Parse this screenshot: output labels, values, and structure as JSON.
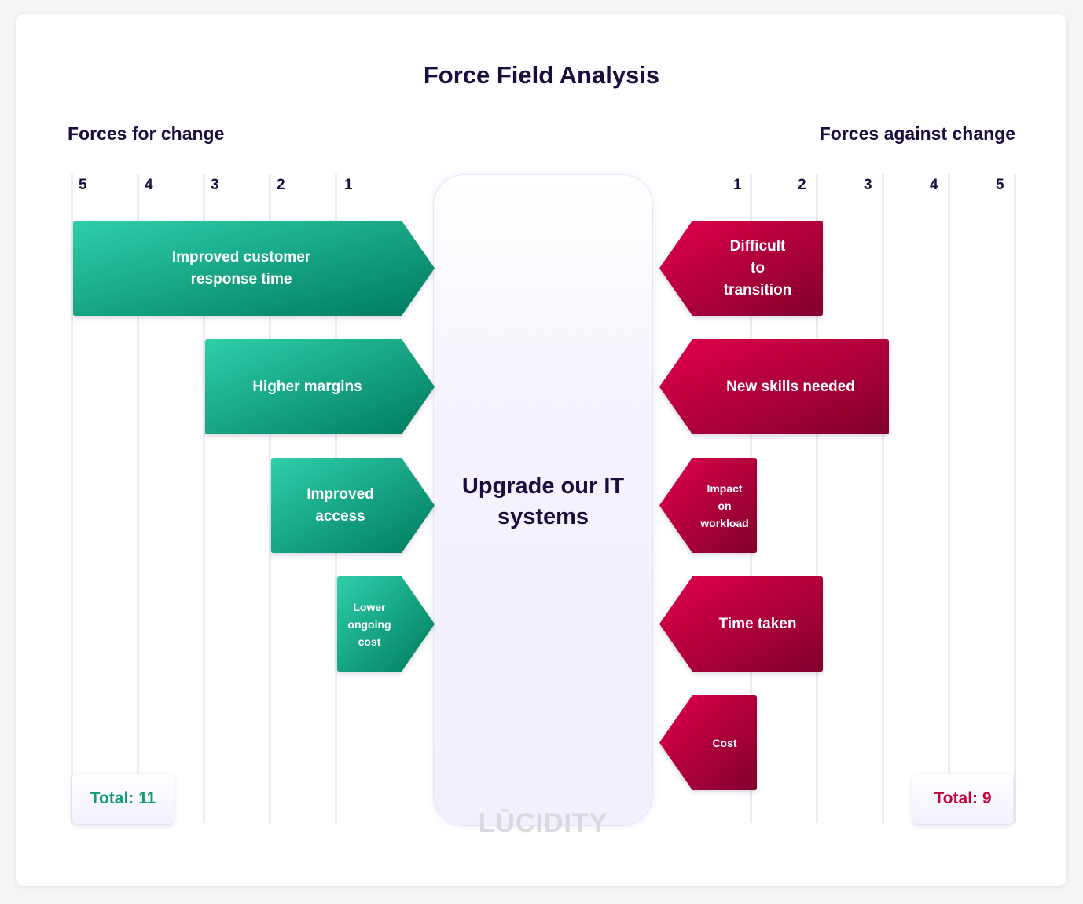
{
  "title": "Force Field Analysis",
  "center_topic": "Upgrade our IT systems",
  "forces_for": {
    "heading": "Forces for change",
    "scale_ticks": [
      "5",
      "4",
      "3",
      "2",
      "1"
    ],
    "total_label": "Total: 11",
    "color_light": "#2ecfa9",
    "color_dark": "#007a5e",
    "items": [
      {
        "label": "Improved customer response time",
        "strength": 5
      },
      {
        "label": "Higher margins",
        "strength": 3
      },
      {
        "label": "Improved access",
        "strength": 2
      },
      {
        "label": "Lower ongoing cost",
        "strength": 1
      }
    ]
  },
  "forces_against": {
    "heading": "Forces against change",
    "scale_ticks": [
      "1",
      "2",
      "3",
      "4",
      "5"
    ],
    "total_label": "Total: 9",
    "color_light": "#e2004b",
    "color_dark": "#80002e",
    "items": [
      {
        "label": "Difficult to transition",
        "strength": 2
      },
      {
        "label": "New skills needed",
        "strength": 3
      },
      {
        "label": "Impact on workload",
        "strength": 1
      },
      {
        "label": "Time taken",
        "strength": 2
      },
      {
        "label": "Cost",
        "strength": 1
      }
    ]
  },
  "watermark": "LŪCIDITY"
}
